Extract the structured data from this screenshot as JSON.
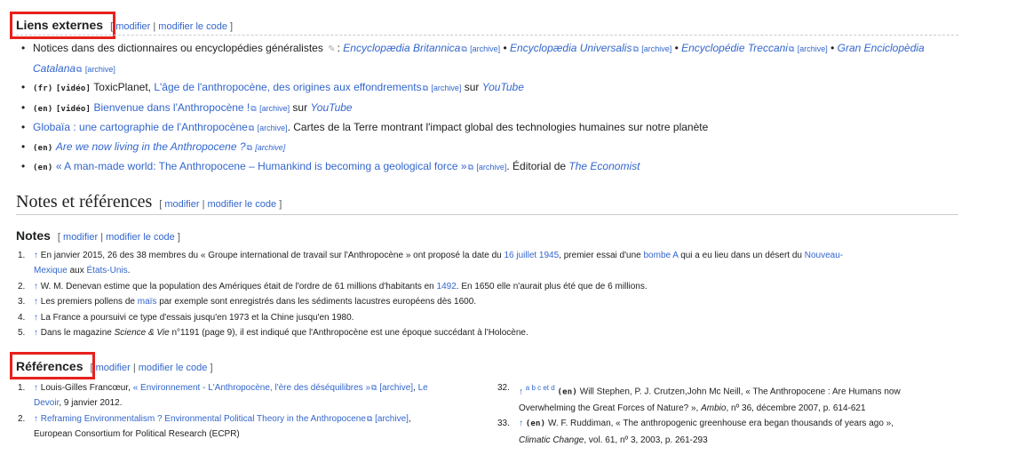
{
  "ext": {
    "title": "Liens externes",
    "edit_left": "[",
    "edit_modifier": "modifier",
    "edit_sep": "|",
    "edit_code": "modifier le code",
    "edit_right": "]",
    "items": [
      {
        "prefix": "Notices dans des dictionnaires ou encyclopédies généralistes",
        "colon": ":",
        "links": [
          "Encyclopædia Britannica",
          "Encyclopædia Universalis",
          "Encyclopédie Treccani",
          "Gran Enciclopèdia Catalana"
        ],
        "archive": "[archive]",
        "bullet": "•"
      },
      {
        "lang": "(fr)",
        "media": "[vidéo]",
        "text1": "ToxicPlanet,",
        "link": "L'âge de l'anthropocène, des origines aux effondrements",
        "archive": "[archive]",
        "on": "sur",
        "site": "YouTube"
      },
      {
        "lang": "(en)",
        "media": "[vidéo]",
        "link": "Bienvenue dans l'Anthropocène !",
        "archive": "[archive]",
        "on": "sur",
        "site": "YouTube"
      },
      {
        "link": "Globaïa : une cartographie de l'Anthropocène",
        "archive": "[archive]",
        "text": ". Cartes de la Terre montrant l'impact global des technologies humaines sur notre planète"
      },
      {
        "lang": "(en)",
        "link": "Are we now living in the Anthropocene ?",
        "archive": "[archive]"
      },
      {
        "lang": "(en)",
        "link": "« A man-made world: The Anthropocene – Humankind is becoming a geological force »",
        "archive": "[archive]",
        "text": ". Éditorial de",
        "pub": "The Economist"
      }
    ]
  },
  "notesrefs": {
    "title": "Notes et références"
  },
  "notes": {
    "title": "Notes",
    "items": [
      {
        "n": "1.",
        "arrow": "↑",
        "t1": "En janvier 2015, 26 des 38 membres du « Groupe international de travail sur l'Anthropocène » ont proposé la date du",
        "l1": "16 juillet 1945",
        "t2": ", premier essai d'une",
        "l2": "bombe A",
        "t3": "qui a eu lieu dans un désert du",
        "l3": "Nouveau-",
        "l3b": "Mexique",
        "t4": "aux",
        "l4": "États-Unis",
        "t5": "."
      },
      {
        "n": "2.",
        "arrow": "↑",
        "t1": "W. M. Denevan estime que la population des Amériques était de l'ordre de 61 millions d'habitants en",
        "l1": "1492",
        "t2": ". En 1650 elle n'aurait plus été que de 6 millions."
      },
      {
        "n": "3.",
        "arrow": "↑",
        "t1": "Les premiers pollens de",
        "l1": "maïs",
        "t2": "par exemple sont enregistrés dans les sédiments lacustres européens dès 1600."
      },
      {
        "n": "4.",
        "arrow": "↑",
        "t1": "La France a poursuivi ce type d'essais jusqu'en 1973 et la Chine jusqu'en 1980."
      },
      {
        "n": "5.",
        "arrow": "↑",
        "t1": "Dans le magazine",
        "i1": "Science & Vie",
        "t2": "n°1191 (page 9), il est indiqué que l'Anthropocène est une époque succédant à l'Holocène."
      }
    ]
  },
  "refs": {
    "title": "Références",
    "left": [
      {
        "n": "1.",
        "arrow": "↑",
        "t1": "Louis-Gilles Francœur,",
        "l1": "« Environnement - L'Anthropocène, l'ère des déséquilibres »",
        "archive": "[archive]",
        "t2": ",",
        "l2": "Le",
        "l2b": "Devoir",
        "t3": ", 9 janvier 2012."
      },
      {
        "n": "2.",
        "arrow": "↑",
        "l1": "Reframing Environmentalism ? Environmental Political Theory in the Anthropocene",
        "archive": "[archive]",
        "t2": ",",
        "t3": "European Consortium for Political Research (ECPR)"
      }
    ],
    "right": [
      {
        "n": "32.",
        "arrow": "↑",
        "letters": "a b c et d",
        "lang": "(en)",
        "t1": "Will Stephen, P. J. Crutzen,John Mc Neill, « The Anthropocene : Are Humans now",
        "t2": "Overwhelming the Great Forces of Nature? »,",
        "i1": "Ambio",
        "t3": ", nº 36, décembre 2007, p. 614-621"
      },
      {
        "n": "33.",
        "arrow": "↑",
        "lang": "(en)",
        "t1": "W. F. Ruddiman, « The anthropogenic greenhouse era began thousands of years ago »,",
        "i1": "Climatic Change",
        "t2": ", vol. 61, nº 3, 2003, p. 261-293"
      }
    ]
  },
  "colors": {
    "link": "#3366cc",
    "text": "#202122",
    "highlight": "#e8201c",
    "rule": "#c8ccd1"
  }
}
